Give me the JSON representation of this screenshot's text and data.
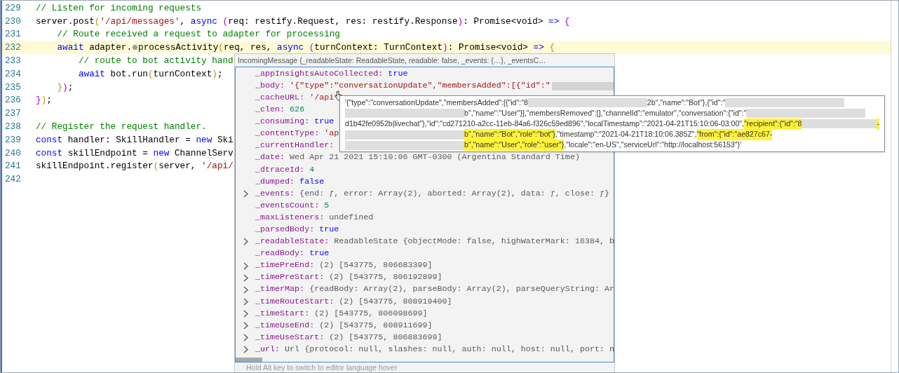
{
  "editor": {
    "lines": [
      {
        "number": "229",
        "current": false,
        "segments": [
          {
            "kind": "comment",
            "text": "// Listen for incoming requests"
          }
        ]
      },
      {
        "number": "230",
        "current": false,
        "segments": [
          {
            "kind": "plain",
            "text": "server.post"
          },
          {
            "kind": "bracket1",
            "text": "("
          },
          {
            "kind": "string",
            "text": "'/api/messages'"
          },
          {
            "kind": "plain",
            "text": ", "
          },
          {
            "kind": "keyword",
            "text": "async"
          },
          {
            "kind": "bracket2",
            "text": " ("
          },
          {
            "kind": "plain",
            "text": "req: restify.Request, res: restify.Response"
          },
          {
            "kind": "bracket2",
            "text": ")"
          },
          {
            "kind": "plain",
            "text": ": Promise<void> "
          },
          {
            "kind": "keyword",
            "text": "=>"
          },
          {
            "kind": "bracket2",
            "text": " {"
          }
        ]
      },
      {
        "number": "231",
        "current": false,
        "segments": [
          {
            "kind": "comment",
            "text": "    // Route received a request to adapter for processing"
          }
        ]
      },
      {
        "number": "232",
        "current": true,
        "segments": [
          {
            "kind": "keyword",
            "text": "    await"
          },
          {
            "kind": "plain",
            "text": " adapter."
          },
          {
            "kind": "breakpoint"
          },
          {
            "kind": "plain",
            "text": "processActivity"
          },
          {
            "kind": "bracket1",
            "text": "("
          },
          {
            "kind": "plain",
            "text": "req, res, "
          },
          {
            "kind": "keyword",
            "text": "async"
          },
          {
            "kind": "bracket2",
            "text": " ("
          },
          {
            "kind": "plain",
            "text": "turnContext: TurnContext"
          },
          {
            "kind": "bracket2",
            "text": ")"
          },
          {
            "kind": "plain",
            "text": ": Promise<void> "
          },
          {
            "kind": "keyword",
            "text": "=>"
          },
          {
            "kind": "bracket1",
            "text": " {"
          }
        ]
      },
      {
        "number": "233",
        "current": false,
        "segments": [
          {
            "kind": "comment",
            "text": "        // route to bot activity hand"
          }
        ]
      },
      {
        "number": "234",
        "current": false,
        "segments": [
          {
            "kind": "keyword",
            "text": "        await"
          },
          {
            "kind": "plain",
            "text": " bot.run"
          },
          {
            "kind": "bracket1",
            "text": "("
          },
          {
            "kind": "plain",
            "text": "turnContext"
          },
          {
            "kind": "bracket1",
            "text": ")"
          },
          {
            "kind": "plain",
            "text": ";"
          }
        ]
      },
      {
        "number": "235",
        "current": false,
        "segments": [
          {
            "kind": "bracket1",
            "text": "    }"
          },
          {
            "kind": "bracket2",
            "text": ")"
          },
          {
            "kind": "plain",
            "text": ";"
          }
        ]
      },
      {
        "number": "236",
        "current": false,
        "segments": [
          {
            "kind": "bracket2",
            "text": "}"
          },
          {
            "kind": "bracket1",
            "text": ")"
          },
          {
            "kind": "plain",
            "text": ";"
          }
        ]
      },
      {
        "number": "237",
        "current": false
      },
      {
        "number": "238",
        "current": false,
        "segments": [
          {
            "kind": "comment",
            "text": "// Register the request handler."
          }
        ]
      },
      {
        "number": "239",
        "current": false,
        "segments": [
          {
            "kind": "keyword",
            "text": "const"
          },
          {
            "kind": "plain",
            "text": " handler: SkillHandler = "
          },
          {
            "kind": "keyword",
            "text": "new"
          },
          {
            "kind": "plain",
            "text": " Ski"
          }
        ]
      },
      {
        "number": "240",
        "current": false,
        "segments": [
          {
            "kind": "keyword",
            "text": "const"
          },
          {
            "kind": "plain",
            "text": " skillEndpoint = "
          },
          {
            "kind": "keyword",
            "text": "new"
          },
          {
            "kind": "plain",
            "text": " ChannelServ"
          }
        ]
      },
      {
        "number": "241",
        "current": false,
        "segments": [
          {
            "kind": "plain",
            "text": "skillEndpoint.register"
          },
          {
            "kind": "bracket1",
            "text": "("
          },
          {
            "kind": "plain",
            "text": "server, "
          },
          {
            "kind": "string",
            "text": "'/api/"
          }
        ]
      },
      {
        "number": "242",
        "current": false
      }
    ]
  },
  "hover": {
    "header": "IncomingMessage {_readableState: ReadableState, readable: false, _events: {…}, _eventsC…",
    "rows": [
      {
        "key": "_appInsightsAutoCollected:",
        "value": "true",
        "kind": "literal",
        "expandable": false
      },
      {
        "key": "_body:",
        "value": "'{\"type\":\"conversationUpdate\",\"membersAdded\":[{\"id\":\"",
        "kind": "string",
        "expandable": false,
        "redacted": true
      },
      {
        "key": "_cacheURL:",
        "value": "'/api",
        "kind": "string",
        "expandable": false
      },
      {
        "key": "_clen:",
        "value": "626",
        "kind": "number",
        "expandable": false
      },
      {
        "key": "_consuming:",
        "value": "true",
        "kind": "literal",
        "expandable": false
      },
      {
        "key": "_contentType:",
        "value": "'ap",
        "kind": "string",
        "expandable": false
      },
      {
        "key": "_currentHandler:",
        "expandable": false
      },
      {
        "key": "_date:",
        "value": "Wed Apr 21 2021 15:10:06 GMT-0300 (Argentina Standard Time)",
        "kind": "plain",
        "expandable": false
      },
      {
        "key": "_dtraceId:",
        "value": "4",
        "kind": "number",
        "expandable": false
      },
      {
        "key": "_dumped:",
        "value": "false",
        "kind": "literal",
        "expandable": false
      },
      {
        "key": "_events:",
        "value": "{end: ƒ, error: Array(2), aborted: Array(2), data: ƒ, close: ƒ}",
        "kind": "plain",
        "expandable": true
      },
      {
        "key": "_eventsCount:",
        "value": "5",
        "kind": "number",
        "expandable": false
      },
      {
        "key": "_maxListeners:",
        "value": "undefined",
        "kind": "plain",
        "expandable": false
      },
      {
        "key": "_parsedBody:",
        "value": "true",
        "kind": "literal",
        "expandable": false
      },
      {
        "key": "_readableState:",
        "value": "ReadableState {objectMode: false, highWaterMark: 16384, b",
        "kind": "plain",
        "expandable": true
      },
      {
        "key": "_readBody:",
        "value": "true",
        "kind": "literal",
        "expandable": false
      },
      {
        "key": "_timePreEnd:",
        "value": "(2) [543775, 806683399]",
        "kind": "plain",
        "expandable": true
      },
      {
        "key": "_timePreStart:",
        "value": "(2) [543775, 806192899]",
        "kind": "plain",
        "expandable": true
      },
      {
        "key": "_timerMap:",
        "value": "{readBody: Array(2), parseBody: Array(2), parseQueryString: Ar",
        "kind": "plain",
        "expandable": true
      },
      {
        "key": "_timeRouteStart:",
        "value": "(2) [543775, 808919400]",
        "kind": "plain",
        "expandable": true
      },
      {
        "key": "_timeStart:",
        "value": "(2) [543775, 806098699]",
        "kind": "plain",
        "expandable": true
      },
      {
        "key": "_timeUseEnd:",
        "value": "(2) [543775, 808911699]",
        "kind": "plain",
        "expandable": true
      },
      {
        "key": "_timeUseStart:",
        "value": "(2) [543775, 806883699]",
        "kind": "plain",
        "expandable": true
      },
      {
        "key": "_url:",
        "value": "Url {protocol: null, slashes: null, auth: null, host: null, port: n",
        "kind": "plain",
        "expandable": true
      }
    ],
    "footer": "Hold Alt key to switch to editor language hover"
  },
  "tooltip": {
    "lines": [
      [
        {
          "kind": "text",
          "text": "'{\"type\":\"conversationUpdate\",\"membersAdded\":[{\"id\":\"8",
          "highlight": false
        },
        {
          "kind": "redacted"
        },
        {
          "kind": "text",
          "text": "2b\",\"name\":\"Bot\"},{\"id\":\"",
          "highlight": false
        },
        {
          "kind": "redacted"
        }
      ],
      [
        {
          "kind": "redacted"
        },
        {
          "kind": "text",
          "text": "b\",\"name\":\"User\"}],\"membersRemoved\":[],\"channelId\":\"emulator\",\"conversation\":{\"id\":\"",
          "highlight": false
        },
        {
          "kind": "redacted"
        }
      ],
      [
        {
          "kind": "text",
          "text": "d1b42fe0952b|livechat\"},\"id\":\"cd271210-a2cc-11eb-84a6-f326c59ed896\",\"localTimestamp\":\"2021-04-21T15:10:06-03:00\",",
          "highlight": false
        },
        {
          "kind": "text",
          "text": "\"recipient\":{\"id\":\"8",
          "highlight": true
        },
        {
          "kind": "redacted"
        },
        {
          "kind": "text",
          "text": "-",
          "highlight": true
        }
      ],
      [
        {
          "kind": "redacted"
        },
        {
          "kind": "text",
          "text": "b\",\"name\":\"Bot\",\"role\":\"bot\"}",
          "highlight": true
        },
        {
          "kind": "text",
          "text": ",\"timestamp\":\"2021-04-21T18:10:06.385Z\",",
          "highlight": false
        },
        {
          "kind": "text",
          "text": "\"from\":{\"id\":\"ae827c67-",
          "highlight": true
        }
      ],
      [
        {
          "kind": "redacted"
        },
        {
          "kind": "text",
          "text": "b\",\"name\":\"User\",\"role\":\"user\"}",
          "highlight": true
        },
        {
          "kind": "text",
          "text": ",\"locale\":\"en-US\",\"serviceUrl\":\"http://localhost:56153\"}'",
          "highlight": false
        }
      ]
    ]
  }
}
